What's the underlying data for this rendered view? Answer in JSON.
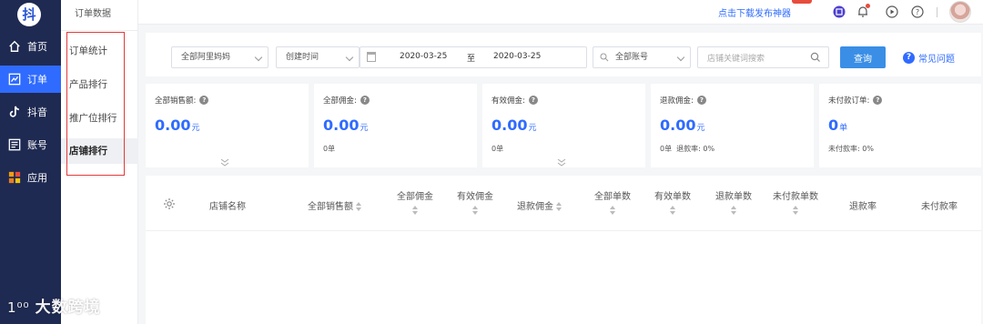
{
  "logo": {
    "text": "抖"
  },
  "nav": {
    "items": [
      {
        "label": "首页",
        "icon": "home-icon"
      },
      {
        "label": "订单",
        "icon": "chart-icon",
        "active": true
      },
      {
        "label": "抖音",
        "icon": "tiktok-icon"
      },
      {
        "label": "账号",
        "icon": "account-icon"
      },
      {
        "label": "应用",
        "icon": "apps-icon"
      }
    ]
  },
  "subnav": {
    "title": "订单数据",
    "items": [
      {
        "label": "订单统计"
      },
      {
        "label": "产品排行"
      },
      {
        "label": "推广位排行"
      },
      {
        "label": "店铺排行",
        "active": true
      }
    ]
  },
  "header": {
    "download_link": "点击下载发布神器",
    "icons": [
      "switch-icon",
      "bell-icon",
      "play-icon",
      "help-icon"
    ]
  },
  "filters": {
    "alimama_select": "全部阿里妈妈",
    "time_type_select": "创建时间",
    "date_start": "2020-03-25",
    "date_separator": "至",
    "date_end": "2020-03-25",
    "account_select": "全部账号",
    "search_placeholder": "店铺关键词搜索",
    "query_button": "查询",
    "faq_link": "常见问题"
  },
  "stats": [
    {
      "label": "全部销售额:",
      "value": "0.00",
      "unit": "元",
      "sub": ""
    },
    {
      "label": "全部佣金:",
      "value": "0.00",
      "unit": "元",
      "sub": "0单"
    },
    {
      "label": "有效佣金:",
      "value": "0.00",
      "unit": "元",
      "sub": "0单"
    },
    {
      "label": "退款佣金:",
      "value": "0.00",
      "unit": "元",
      "sub": "0单  退款率: 0%"
    },
    {
      "label": "未付款订单:",
      "value": "0",
      "unit": "单",
      "sub": "未付款率: 0%"
    }
  ],
  "table": {
    "columns": [
      "店铺名称",
      "全部销售额",
      "全部佣金",
      "有效佣金",
      "退款佣金",
      "全部单数",
      "有效单数",
      "退款单数",
      "未付款单数",
      "退款率",
      "未付款率"
    ]
  },
  "watermark": {
    "mark": "1⁰⁰",
    "text": "大数跨境"
  },
  "colors": {
    "accent": "#2f6bff",
    "nav_bg": "#1f2a52",
    "highlight_box": "#e23a3a"
  }
}
